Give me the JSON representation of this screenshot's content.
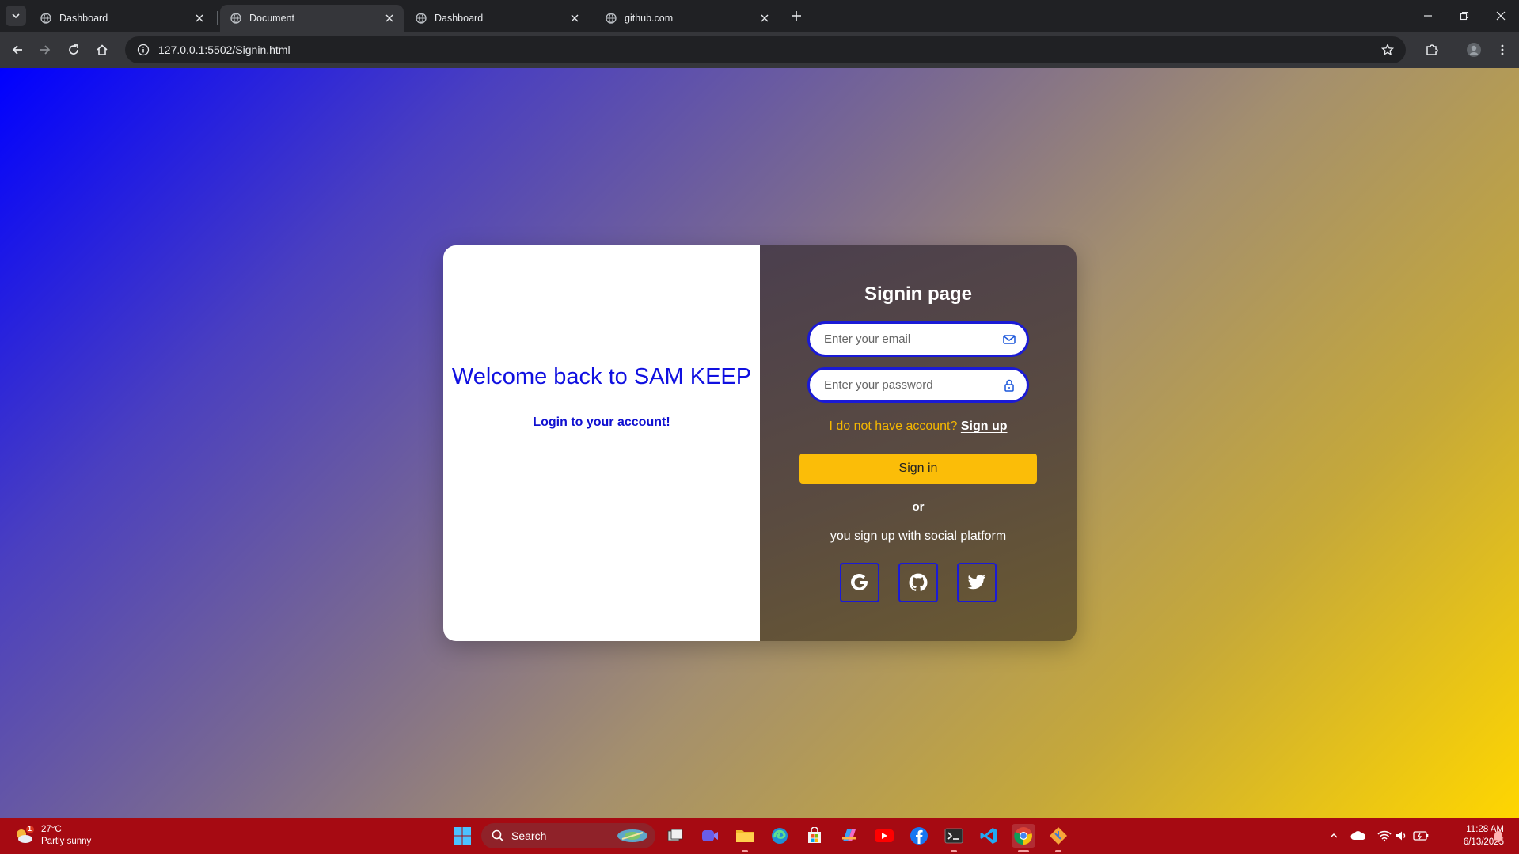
{
  "browser": {
    "tabs": [
      {
        "title": "Dashboard",
        "active": false
      },
      {
        "title": "Document",
        "active": true
      },
      {
        "title": "Dashboard",
        "active": false
      },
      {
        "title": "github.com",
        "active": false
      }
    ],
    "url": "127.0.0.1:5502/Signin.html"
  },
  "page": {
    "welcome_heading": "Welcome back to SAM KEEP",
    "welcome_subtitle": "Login to your account!",
    "form_title": "Signin page",
    "email_placeholder": "Enter your email",
    "password_placeholder": "Enter your password",
    "no_account_text": "I do not have account?",
    "signup_link": "Sign up",
    "signin_button": "Sign in",
    "or_text": "or",
    "social_text": "you sign up with social platform",
    "social_buttons": [
      "google-icon",
      "github-icon",
      "twitter-icon"
    ],
    "colors": {
      "accent_blue": "#1a1ad6",
      "accent_yellow": "#fbbd08",
      "gradient_start": "#0000ff",
      "gradient_end": "#ffd600"
    }
  },
  "taskbar": {
    "weather_temp": "27°C",
    "weather_desc": "Partly sunny",
    "weather_badge": "1",
    "search_label": "Search",
    "time": "11:28 AM",
    "date": "6/13/2025",
    "colors": {
      "background": "#a60a12"
    }
  }
}
